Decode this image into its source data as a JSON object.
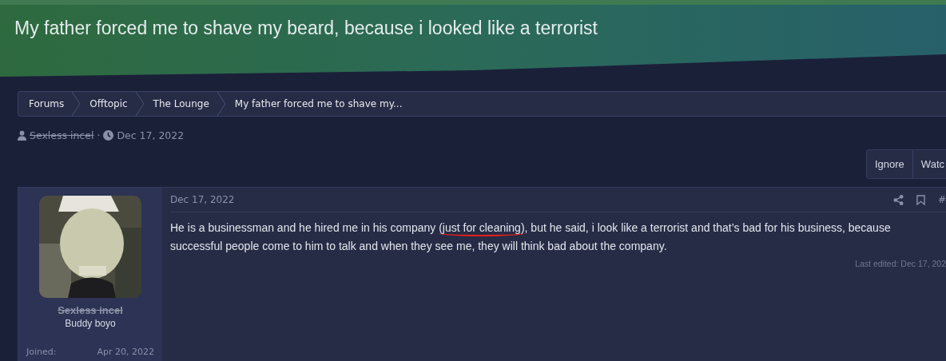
{
  "header": {
    "title": "My father forced me to shave my beard, because i looked like a terrorist"
  },
  "breadcrumb": [
    {
      "label": "Forums"
    },
    {
      "label": "Offtopic"
    },
    {
      "label": "The Lounge"
    },
    {
      "label": "My father forced me to shave my..."
    }
  ],
  "thread_meta": {
    "author": "Sexless incel",
    "author_banned": true,
    "separator": "·",
    "date": "Dec 17, 2022"
  },
  "thread_actions": [
    "Ignore",
    "Watc"
  ],
  "post": {
    "user": {
      "name": "Sexless incel",
      "banned": true,
      "title": "Buddy boyo",
      "stats": [
        {
          "label": "Joined:",
          "value": "Apr 20, 2022"
        }
      ]
    },
    "date": "Dec 17, 2022",
    "post_number": "#",
    "body": [
      {
        "text": "He is a businessman and he hired me in his company ",
        "underlined": false
      },
      {
        "text": "(just for cleaning)",
        "underlined": true
      },
      {
        "text": ", but he said, i look like a terrorist and that’s bad for his business, because successful people come to him to talk and when they see me, they will think bad about the company.",
        "underlined": false
      }
    ],
    "last_edited": "Last edited: Dec 17, 202"
  }
}
